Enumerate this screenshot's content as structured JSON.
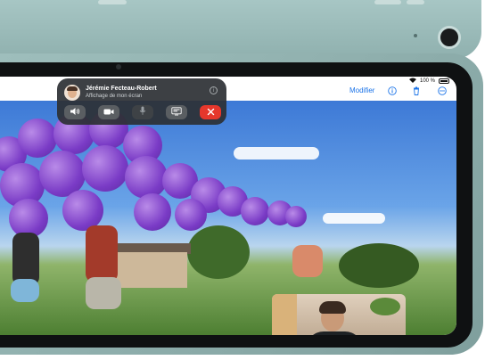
{
  "status_bar": {
    "wifi": "wifi-icon",
    "battery_percent": "100 %"
  },
  "toolbar": {
    "edit_label": "Modifier",
    "icons": [
      "info-icon",
      "trash-icon",
      "more-icon"
    ],
    "accent_color": "#1a73e8"
  },
  "facetime": {
    "caller_name": "Jérémie Fecteau-Robert",
    "subtitle": "Affichage de mon écran",
    "info_icon": "info-icon",
    "controls": [
      "speaker-icon",
      "camera-icon",
      "mute-icon",
      "shareplay-icon",
      "end-call-icon"
    ],
    "end_call_color": "#e5372c"
  },
  "device_color": "#8fb0ae"
}
